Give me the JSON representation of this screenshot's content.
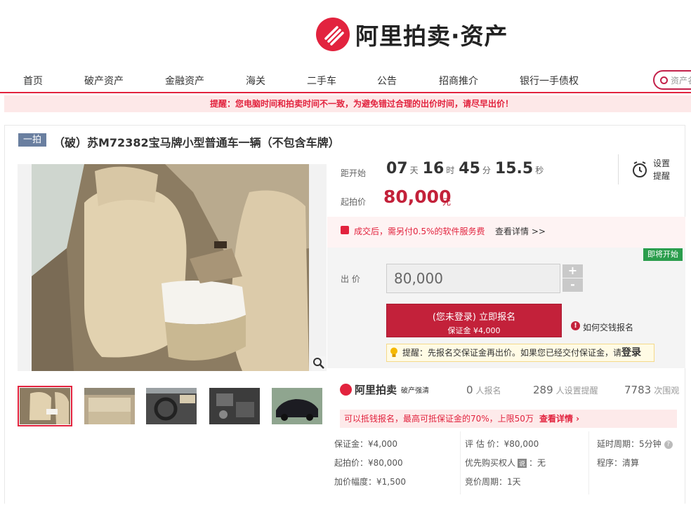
{
  "brand": {
    "name": "阿里拍卖·资产"
  },
  "nav": {
    "items": [
      "首页",
      "破产资产",
      "金融资产",
      "海关",
      "二手车",
      "公告",
      "招商推介",
      "银行一手债权"
    ],
    "search_placeholder": "资产名"
  },
  "notice": "提醒：您电脑时间和拍卖时间不一致，为避免错过合理的出价时间，请尽早出价！",
  "item": {
    "badge": "一拍",
    "title": "（破）苏M72382宝马牌小型普通车一辆（不包含车牌）"
  },
  "countdown": {
    "label": "距开始",
    "days": "07",
    "days_unit": "天",
    "hours": "16",
    "hours_unit": "时",
    "minutes": "45",
    "minutes_unit": "分",
    "seconds": "15.5",
    "seconds_unit": "秒"
  },
  "reminder": {
    "line1": "设置",
    "line2": "提醒"
  },
  "start_price": {
    "label": "起拍价",
    "value": "80,000",
    "unit": "元"
  },
  "fee": {
    "text": "成交后，需另付0.5%的软件服务费",
    "link": "查看详情 >>"
  },
  "bid": {
    "status_badge": "即将开始",
    "label": "出 价",
    "input_value": "80,000",
    "plus": "+",
    "minus": "-",
    "register_line1": "(您未登录) 立即报名",
    "register_line2": "保证金 ¥4,000",
    "how_to": "如何交钱报名",
    "tip_text": "提醒：先报名交保证金再出价。如果您已经交付保证金，请",
    "tip_login": "登录"
  },
  "stats_brand": {
    "name": "阿里拍卖",
    "sub": "破产强清"
  },
  "stats": [
    {
      "num": "0",
      "label": "人报名"
    },
    {
      "num": "289",
      "label": "人设置提醒"
    },
    {
      "num": "7783",
      "label": "次围观"
    }
  ],
  "deduct": {
    "text": "可以抵钱报名，最高可抵保证金的70%，上限50万",
    "more": "查看详情 ›"
  },
  "details": {
    "deposit": "保证金：¥4,000",
    "start": "起拍价：¥80,000",
    "increment": "加价幅度：¥1,500",
    "appraisal": "评 估 价：¥80,000",
    "priority_prefix": "优先购买权人",
    "priority_badge": "说",
    "priority_suffix": "：无",
    "cycle": "竞价周期：1天",
    "delay": "延时周期：5分钟",
    "procedure": "程序：清算"
  },
  "colors": {
    "accent": "#e2233e",
    "price": "#c3213a",
    "badge_green": "#2a9d4c",
    "badge_blue": "#6a7fa0"
  },
  "icons": [
    "logo-icon",
    "search-icon",
    "alarm-clock-icon",
    "zoom-icon",
    "gift-icon",
    "info-icon",
    "bulb-icon",
    "help-icon"
  ]
}
